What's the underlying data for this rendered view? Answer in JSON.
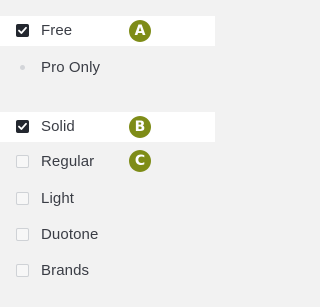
{
  "filters": {
    "group1": {
      "items": [
        {
          "label": "Free",
          "checked": true
        },
        {
          "label": "Pro Only",
          "checked": false
        }
      ]
    },
    "group2": {
      "items": [
        {
          "label": "Solid",
          "checked": true
        },
        {
          "label": "Regular",
          "checked": false
        },
        {
          "label": "Light",
          "checked": false
        },
        {
          "label": "Duotone",
          "checked": false
        },
        {
          "label": "Brands",
          "checked": false
        }
      ]
    }
  },
  "annotations": {
    "a": "A",
    "b": "B",
    "c": "C"
  },
  "colors": {
    "badge": "#7e8c17",
    "checkbox_checked": "#23272f",
    "highlight_row": "#ffffff",
    "background": "#f2f2f2"
  }
}
